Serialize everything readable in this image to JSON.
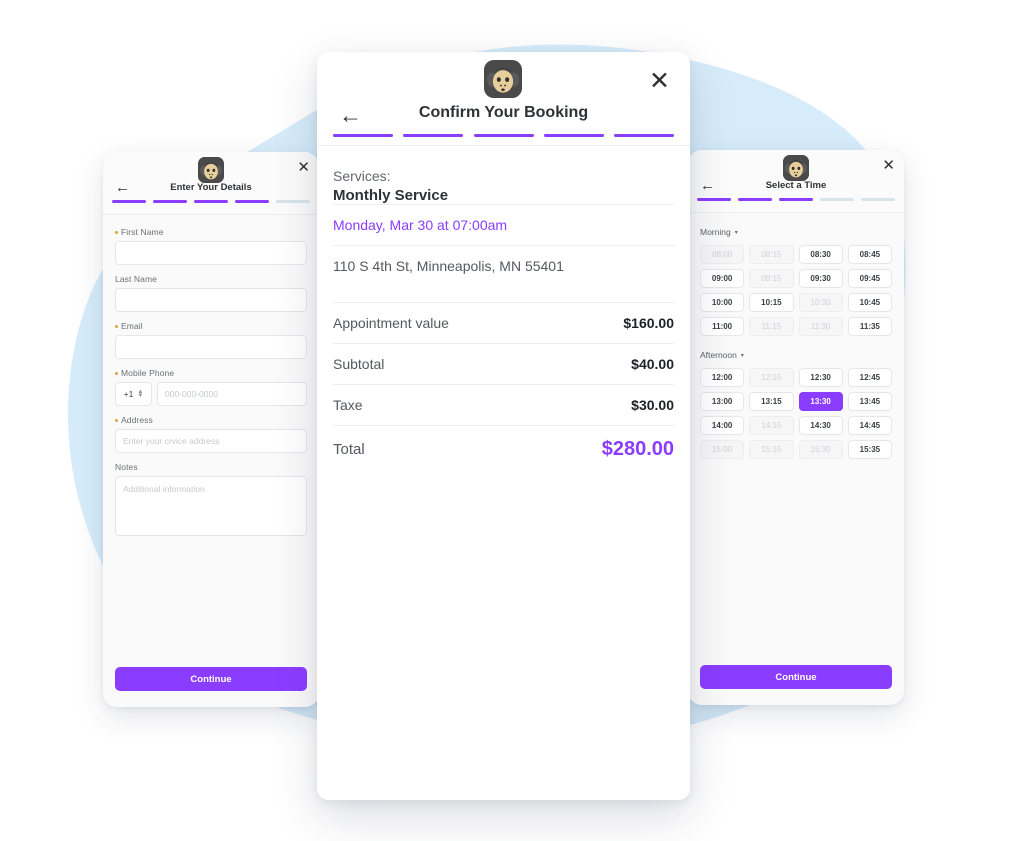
{
  "theme": {
    "accent": "#8B3DFF",
    "blob": "#D6ECFA",
    "card_bg": "#FAFAFA",
    "required_dot": "#E0A33A"
  },
  "logo": {
    "icon": "gorilla-logo-icon",
    "alt": "Gorilla logo"
  },
  "common": {
    "close_icon": "✕",
    "back_icon": "←",
    "caret_icon": "▾",
    "continue_label": "Continue"
  },
  "left_card": {
    "title": "Enter Your Details",
    "steps": [
      true,
      true,
      true,
      true,
      false
    ],
    "fields": {
      "first_name": {
        "label": "First Name",
        "required": true,
        "value": "",
        "placeholder": ""
      },
      "last_name": {
        "label": "Last Name",
        "required": false,
        "value": "",
        "placeholder": ""
      },
      "email": {
        "label": "Email",
        "required": true,
        "value": "",
        "placeholder": ""
      },
      "mobile_phone": {
        "label": "Mobile Phone",
        "required": true,
        "country_code": "+1",
        "value": "",
        "placeholder": "000-000-0000"
      },
      "address": {
        "label": "Address",
        "required": true,
        "value": "",
        "placeholder": "Enter your crvice address"
      },
      "notes": {
        "label": "Notes",
        "required": false,
        "value": "",
        "placeholder": "Additional information"
      }
    },
    "continue_label": "Continue"
  },
  "center_card": {
    "title": "Confirm Your Booking",
    "steps": [
      true,
      true,
      true,
      true,
      true
    ],
    "services_label": "Services:",
    "service_name": "Monthly Service",
    "datetime": "Monday, Mar 30 at 07:00am",
    "address": "110 S 4th St, Minneapolis, MN 55401",
    "lines": [
      {
        "key": "Appointment value",
        "value": "$160.00"
      },
      {
        "key": "Subtotal",
        "value": "$40.00"
      },
      {
        "key": "Taxe",
        "value": "$30.00"
      }
    ],
    "total": {
      "key": "Total",
      "value": "$280.00"
    }
  },
  "right_card": {
    "title": "Select a Time",
    "steps": [
      true,
      true,
      true,
      false,
      false
    ],
    "groups": [
      {
        "name": "Morning",
        "slots": [
          {
            "time": "08:00",
            "state": "disabled"
          },
          {
            "time": "08:15",
            "state": "disabled"
          },
          {
            "time": "08:30",
            "state": "available"
          },
          {
            "time": "08:45",
            "state": "available"
          },
          {
            "time": "09:00",
            "state": "available"
          },
          {
            "time": "09:15",
            "state": "disabled"
          },
          {
            "time": "09:30",
            "state": "available"
          },
          {
            "time": "09:45",
            "state": "available"
          },
          {
            "time": "10:00",
            "state": "available"
          },
          {
            "time": "10:15",
            "state": "available"
          },
          {
            "time": "10:30",
            "state": "disabled"
          },
          {
            "time": "10:45",
            "state": "available"
          },
          {
            "time": "11:00",
            "state": "available"
          },
          {
            "time": "11:15",
            "state": "disabled"
          },
          {
            "time": "11:30",
            "state": "disabled"
          },
          {
            "time": "11:35",
            "state": "available"
          }
        ]
      },
      {
        "name": "Afternoon",
        "slots": [
          {
            "time": "12:00",
            "state": "available"
          },
          {
            "time": "12:15",
            "state": "disabled"
          },
          {
            "time": "12:30",
            "state": "available"
          },
          {
            "time": "12:45",
            "state": "available"
          },
          {
            "time": "13:00",
            "state": "available"
          },
          {
            "time": "13:15",
            "state": "available"
          },
          {
            "time": "13:30",
            "state": "selected"
          },
          {
            "time": "13:45",
            "state": "available"
          },
          {
            "time": "14:00",
            "state": "available"
          },
          {
            "time": "14:15",
            "state": "disabled"
          },
          {
            "time": "14:30",
            "state": "available"
          },
          {
            "time": "14:45",
            "state": "available"
          },
          {
            "time": "15:00",
            "state": "disabled"
          },
          {
            "time": "15:15",
            "state": "disabled"
          },
          {
            "time": "15:30",
            "state": "disabled"
          },
          {
            "time": "15:35",
            "state": "available"
          }
        ]
      }
    ],
    "continue_label": "Continue"
  }
}
